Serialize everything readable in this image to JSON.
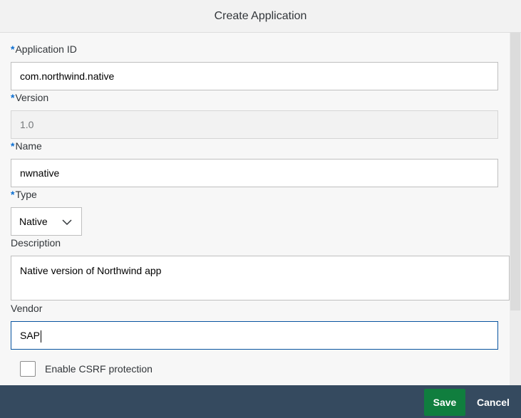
{
  "dialog": {
    "title": "Create Application"
  },
  "form": {
    "required_marker": "*",
    "application_id": {
      "label": "Application ID",
      "value": "com.northwind.native"
    },
    "version": {
      "label": "Version",
      "value": "1.0"
    },
    "name": {
      "label": "Name",
      "value": "nwnative"
    },
    "type": {
      "label": "Type",
      "value": "Native",
      "icon": "chevron-down-icon"
    },
    "description": {
      "label": "Description",
      "value": "Native version of Northwind app"
    },
    "vendor": {
      "label": "Vendor",
      "value": "SAP"
    },
    "csrf": {
      "label": "Enable CSRF protection",
      "checked": false
    }
  },
  "footer": {
    "save_label": "Save",
    "cancel_label": "Cancel"
  },
  "colors": {
    "save_button": "#107e3e",
    "footer_bar": "#354a5f",
    "required_asterisk": "#0a6ed1",
    "focus_border": "#0854a0"
  }
}
